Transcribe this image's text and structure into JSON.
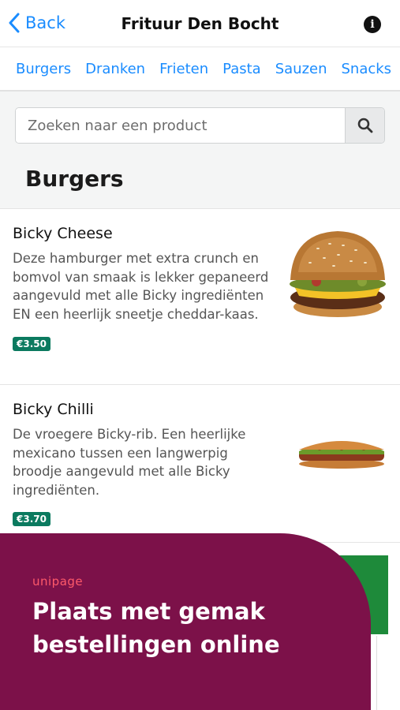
{
  "header": {
    "back_label": "Back",
    "title": "Frituur Den Bocht",
    "info_symbol": "i"
  },
  "categories": [
    "Burgers",
    "Dranken",
    "Frieten",
    "Pasta",
    "Sauzen",
    "Snacks"
  ],
  "search": {
    "placeholder": "Zoeken naar een product"
  },
  "section": {
    "title": "Burgers"
  },
  "products": [
    {
      "name": "Bicky Cheese",
      "description": "Deze hamburger met extra crunch en bomvol van smaak is lekker gepaneerd aangevuld met alle Bicky ingrediënten EN een heerlijk sneetje cheddar-kaas.",
      "price": "€3.50"
    },
    {
      "name": "Bicky Chilli",
      "description": "De vroegere Bicky-rib. Een heerlijke mexicano tussen een langwerpig broodje aangevuld met alle Bicky ingrediënten.",
      "price": "€3.70"
    }
  ],
  "promo": {
    "brand": "unipage",
    "line1": "Plaats met gemak",
    "line2": "bestellingen online"
  },
  "colors": {
    "accent": "#1a8cff",
    "price_badge": "#0b7a5f",
    "promo_bg": "#7c1149",
    "brand": "#ff5a6a"
  }
}
